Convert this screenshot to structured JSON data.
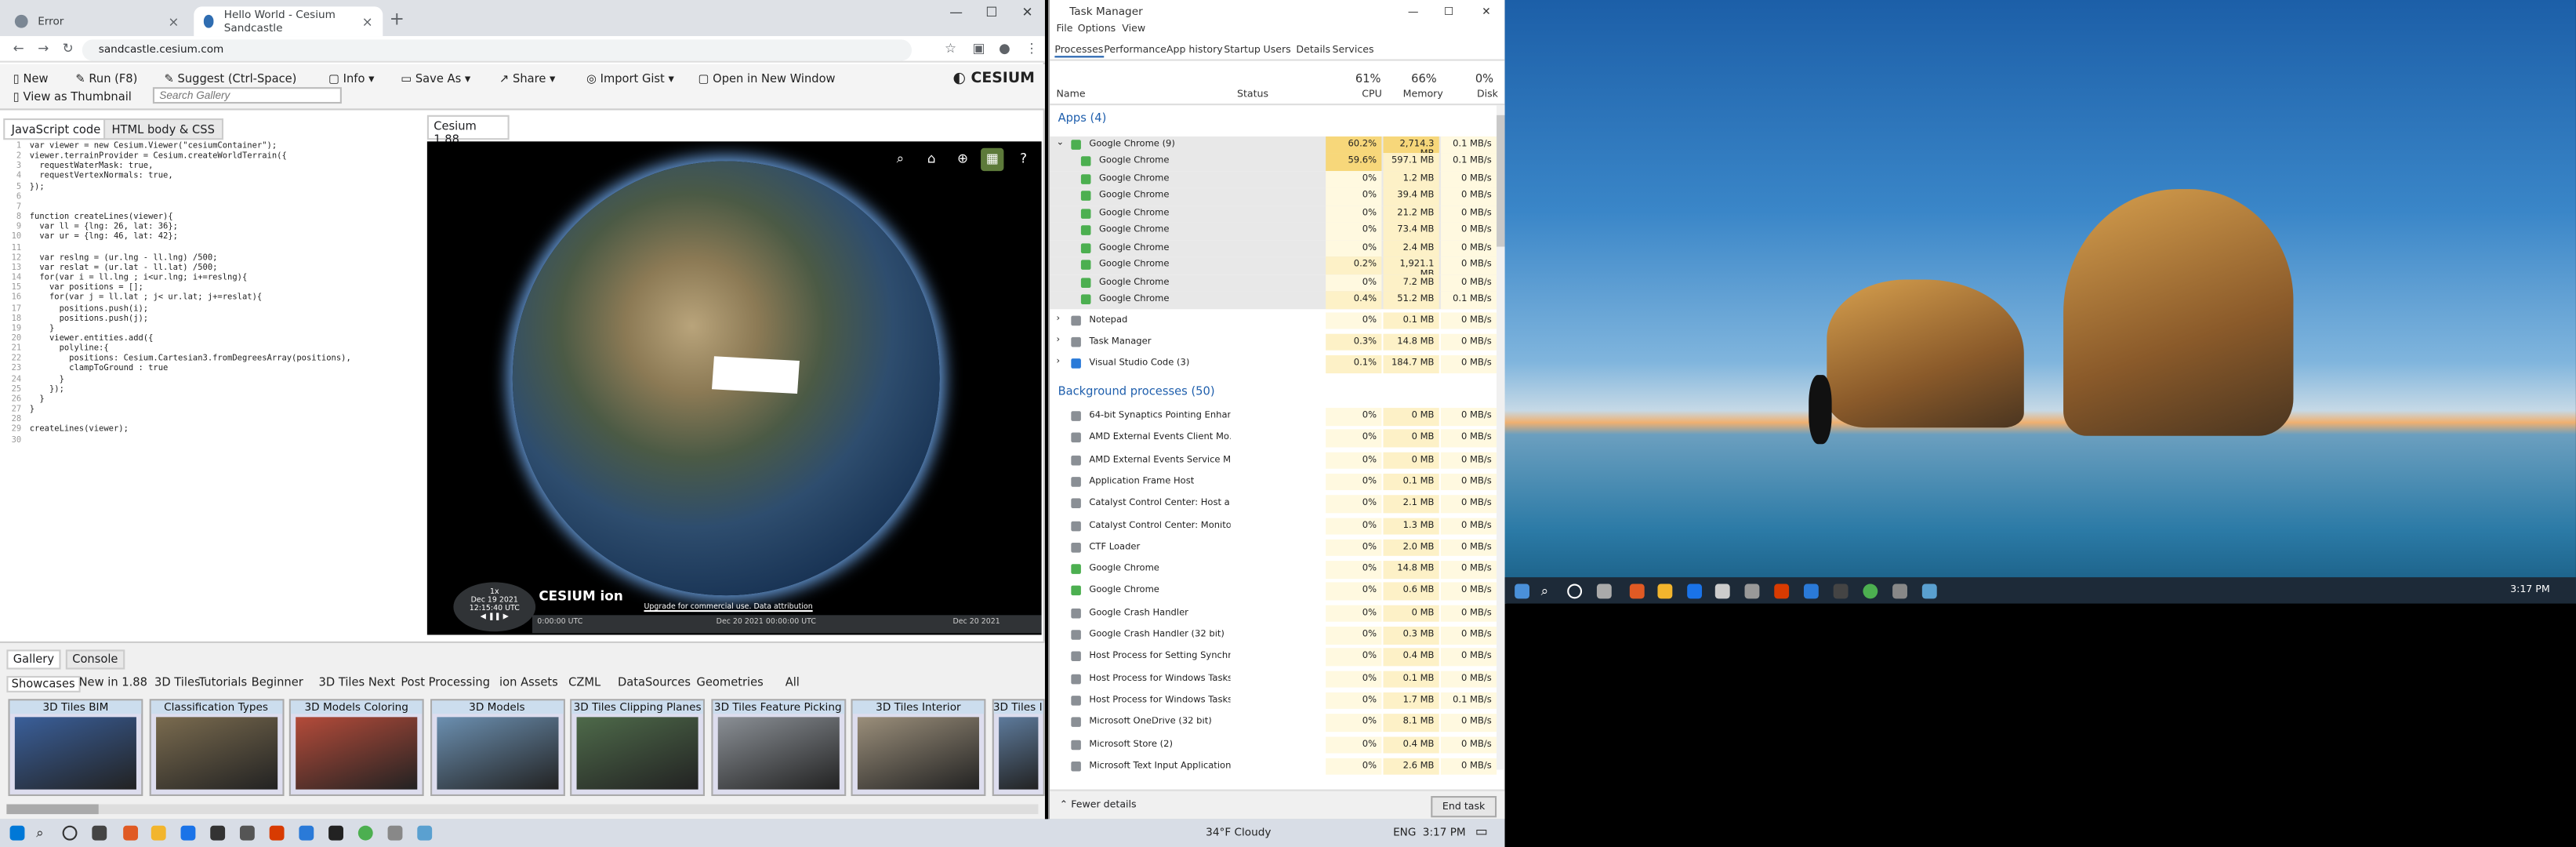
{
  "chrome": {
    "tabs": [
      {
        "label": "Error",
        "favicon_color": "#7b8794"
      },
      {
        "label": "Hello World - Cesium Sandcastle",
        "favicon_color": "#2f6db1"
      }
    ],
    "url": "sandcastle.cesium.com",
    "toolbar": {
      "new": "New",
      "run": "Run (F8)",
      "suggest": "Suggest (Ctrl-Space)",
      "info": "Info",
      "save_as": "Save As",
      "share": "Share",
      "import_gist": "Import Gist",
      "open_new_window": "Open in New Window",
      "view_thumbnail": "View as Thumbnail",
      "search_placeholder": "Search Gallery",
      "logo": "CESIUM"
    },
    "editor_tabs": [
      "JavaScript code",
      "HTML body & CSS"
    ],
    "viewer_tab": "Cesium 1.88",
    "code_lines": [
      "var viewer = new Cesium.Viewer(\"cesiumContainer\");",
      "viewer.terrainProvider = Cesium.createWorldTerrain({",
      "  requestWaterMask: true,",
      "  requestVertexNormals: true,",
      "});",
      "",
      "",
      "function createLines(viewer){",
      "  var ll = {lng: 26, lat: 36};",
      "  var ur = {lng: 46, lat: 42};",
      "",
      "  var reslng = (ur.lng - ll.lng) /500;",
      "  var reslat = (ur.lat - ll.lat) /500;",
      "  for(var i = ll.lng ; i<ur.lng; i+=reslng){",
      "    var positions = [];",
      "    for(var j = ll.lat ; j< ur.lat; j+=reslat){",
      "      positions.push(i);",
      "      positions.push(j);",
      "    }",
      "    viewer.entities.add({",
      "      polyline:{",
      "        positions: Cesium.Cartesian3.fromDegreesArray(positions),",
      "        clampToGround : true",
      "      }",
      "    });",
      "  }",
      "}",
      "",
      "createLines(viewer);",
      ""
    ],
    "viewer": {
      "clock_speed": "1x",
      "clock_date": "Dec 19 2021",
      "clock_time": "12:15:40 UTC",
      "ion_text": "CESIUM ion",
      "attribution_1": "Upgrade for commercial use.",
      "attribution_2": "Data attribution",
      "timeline_1": "Dec 20 2021 00:00:00 UTC",
      "timeline_2": "Dec 20 2021 00:00:00 UTC",
      "timeline_3": "Dec 20 2021",
      "timeline_0": "0:00:00 UTC"
    },
    "gallery_tabs": [
      "Gallery",
      "Console"
    ],
    "gallery_categories": [
      "Showcases",
      "New in 1.88",
      "3D Tiles",
      "Tutorials",
      "Beginner",
      "3D Tiles Next",
      "Post Processing",
      "ion Assets",
      "CZML",
      "DataSources",
      "Geometries",
      "All"
    ],
    "thumbnails": [
      {
        "label": "3D Tiles BIM",
        "color": "#3a5f9a"
      },
      {
        "label": "Classification Types",
        "color": "#7a6b4f"
      },
      {
        "label": "3D Models Coloring",
        "color": "#b44b3a"
      },
      {
        "label": "3D Models",
        "color": "#6b8fb0"
      },
      {
        "label": "3D Tiles Clipping Planes",
        "color": "#4e6a4a"
      },
      {
        "label": "3D Tiles Feature Picking",
        "color": "#8a8f95"
      },
      {
        "label": "3D Tiles Interior",
        "color": "#9a8e7a"
      },
      {
        "label": "3D Tiles I",
        "color": "#5d7a9b"
      }
    ]
  },
  "taskmanager": {
    "title": "Task Manager",
    "menu": [
      "File",
      "Options",
      "View"
    ],
    "tabs": [
      "Processes",
      "Performance",
      "App history",
      "Startup",
      "Users",
      "Details",
      "Services"
    ],
    "headers": {
      "name": "Name",
      "status": "Status",
      "cpu_pct": "61%",
      "cpu": "CPU",
      "mem_pct": "66%",
      "mem": "Memory",
      "disk_pct": "0%",
      "disk": "Disk"
    },
    "apps_label": "Apps (4)",
    "bg_label": "Background processes (50)",
    "apps": [
      {
        "name": "Google Chrome (9)",
        "cpu": "60.2%",
        "mem": "2,714.3 MB",
        "disk": "0.1 MB/s"
      },
      {
        "name": "Google Chrome",
        "cpu": "59.6%",
        "mem": "597.1 MB",
        "disk": "0.1 MB/s"
      },
      {
        "name": "Google Chrome",
        "cpu": "0%",
        "mem": "1.2 MB",
        "disk": "0 MB/s"
      },
      {
        "name": "Google Chrome",
        "cpu": "0%",
        "mem": "39.4 MB",
        "disk": "0 MB/s"
      },
      {
        "name": "Google Chrome",
        "cpu": "0%",
        "mem": "21.2 MB",
        "disk": "0 MB/s"
      },
      {
        "name": "Google Chrome",
        "cpu": "0%",
        "mem": "73.4 MB",
        "disk": "0 MB/s"
      },
      {
        "name": "Google Chrome",
        "cpu": "0%",
        "mem": "2.4 MB",
        "disk": "0 MB/s"
      },
      {
        "name": "Google Chrome",
        "cpu": "0.2%",
        "mem": "1,921.1 MB",
        "disk": "0 MB/s"
      },
      {
        "name": "Google Chrome",
        "cpu": "0%",
        "mem": "7.2 MB",
        "disk": "0 MB/s"
      },
      {
        "name": "Google Chrome",
        "cpu": "0.4%",
        "mem": "51.2 MB",
        "disk": "0.1 MB/s"
      },
      {
        "name": "Notepad",
        "cpu": "0%",
        "mem": "0.1 MB",
        "disk": "0 MB/s"
      },
      {
        "name": "Task Manager",
        "cpu": "0.3%",
        "mem": "14.8 MB",
        "disk": "0 MB/s"
      },
      {
        "name": "Visual Studio Code (3)",
        "cpu": "0.1%",
        "mem": "184.7 MB",
        "disk": "0 MB/s"
      }
    ],
    "bg": [
      {
        "name": "64-bit Synaptics Pointing Enhan...",
        "cpu": "0%",
        "mem": "0 MB",
        "disk": "0 MB/s"
      },
      {
        "name": "AMD External Events Client Mo...",
        "cpu": "0%",
        "mem": "0 MB",
        "disk": "0 MB/s"
      },
      {
        "name": "AMD External Events Service M...",
        "cpu": "0%",
        "mem": "0 MB",
        "disk": "0 MB/s"
      },
      {
        "name": "Application Frame Host",
        "cpu": "0%",
        "mem": "0.1 MB",
        "disk": "0 MB/s"
      },
      {
        "name": "Catalyst Control Center: Host a...",
        "cpu": "0%",
        "mem": "2.1 MB",
        "disk": "0 MB/s"
      },
      {
        "name": "Catalyst Control Center: Monito...",
        "cpu": "0%",
        "mem": "1.3 MB",
        "disk": "0 MB/s"
      },
      {
        "name": "CTF Loader",
        "cpu": "0%",
        "mem": "2.0 MB",
        "disk": "0 MB/s"
      },
      {
        "name": "Google Chrome",
        "cpu": "0%",
        "mem": "14.8 MB",
        "disk": "0 MB/s"
      },
      {
        "name": "Google Chrome",
        "cpu": "0%",
        "mem": "0.6 MB",
        "disk": "0 MB/s"
      },
      {
        "name": "Google Crash Handler",
        "cpu": "0%",
        "mem": "0 MB",
        "disk": "0 MB/s"
      },
      {
        "name": "Google Crash Handler (32 bit)",
        "cpu": "0%",
        "mem": "0.3 MB",
        "disk": "0 MB/s"
      },
      {
        "name": "Host Process for Setting Synchr...",
        "cpu": "0%",
        "mem": "0.4 MB",
        "disk": "0 MB/s"
      },
      {
        "name": "Host Process for Windows Tasks",
        "cpu": "0%",
        "mem": "0.1 MB",
        "disk": "0 MB/s"
      },
      {
        "name": "Host Process for Windows Tasks",
        "cpu": "0%",
        "mem": "1.7 MB",
        "disk": "0.1 MB/s"
      },
      {
        "name": "Microsoft OneDrive (32 bit)",
        "cpu": "0%",
        "mem": "8.1 MB",
        "disk": "0 MB/s"
      },
      {
        "name": "Microsoft Store (2)",
        "cpu": "0%",
        "mem": "0.4 MB",
        "disk": "0 MB/s"
      },
      {
        "name": "Microsoft Text Input Application",
        "cpu": "0%",
        "mem": "2.6 MB",
        "disk": "0 MB/s"
      }
    ],
    "fewer_details": "Fewer details",
    "end_task": "End task"
  },
  "taskbar": {
    "weather": "34°F  Cloudy",
    "lang": "ENG",
    "time": "3:17 PM",
    "desktop_time": "3:17 PM"
  }
}
